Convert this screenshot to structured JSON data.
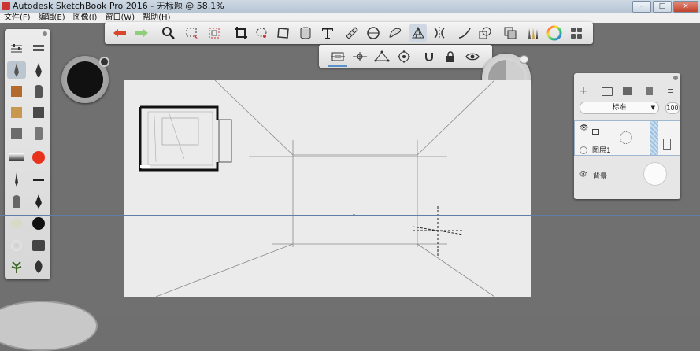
{
  "window": {
    "title": "Autodesk SketchBook Pro 2016 - 无标题 @ 58.1%",
    "min": "–",
    "max": "□",
    "close": "×"
  },
  "menu": [
    "文件(F)",
    "编辑(E)",
    "图像(I)",
    "窗口(W)",
    "帮助(H)"
  ],
  "toolbar": {
    "icons": [
      "undo-icon",
      "redo-icon",
      "zoom-icon",
      "select-icon",
      "transform-icon",
      "crop-icon",
      "lasso-icon",
      "distort-icon",
      "text-icon",
      "ruler-icon",
      "ellipse-icon",
      "french-curve-icon",
      "perspective-icon",
      "symmetry-icon",
      "curve-icon",
      "shape-icon",
      "copy-icon",
      "brush-set-icon",
      "color-wheel-icon",
      "palette-icon"
    ]
  },
  "perspective_toolbar": {
    "icons": [
      "one-point-icon",
      "two-point-icon",
      "three-point-icon",
      "five-point-icon",
      "magnet-icon",
      "lock-icon",
      "eye-icon"
    ]
  },
  "layers": {
    "blend_mode": "标准",
    "opacity": "100",
    "layer1_name": "图层1",
    "background_name": "背景"
  },
  "colors": {
    "accent": "#5a90c8",
    "brush_puck_color": "#111111",
    "red_swatch": "#e8321b"
  }
}
